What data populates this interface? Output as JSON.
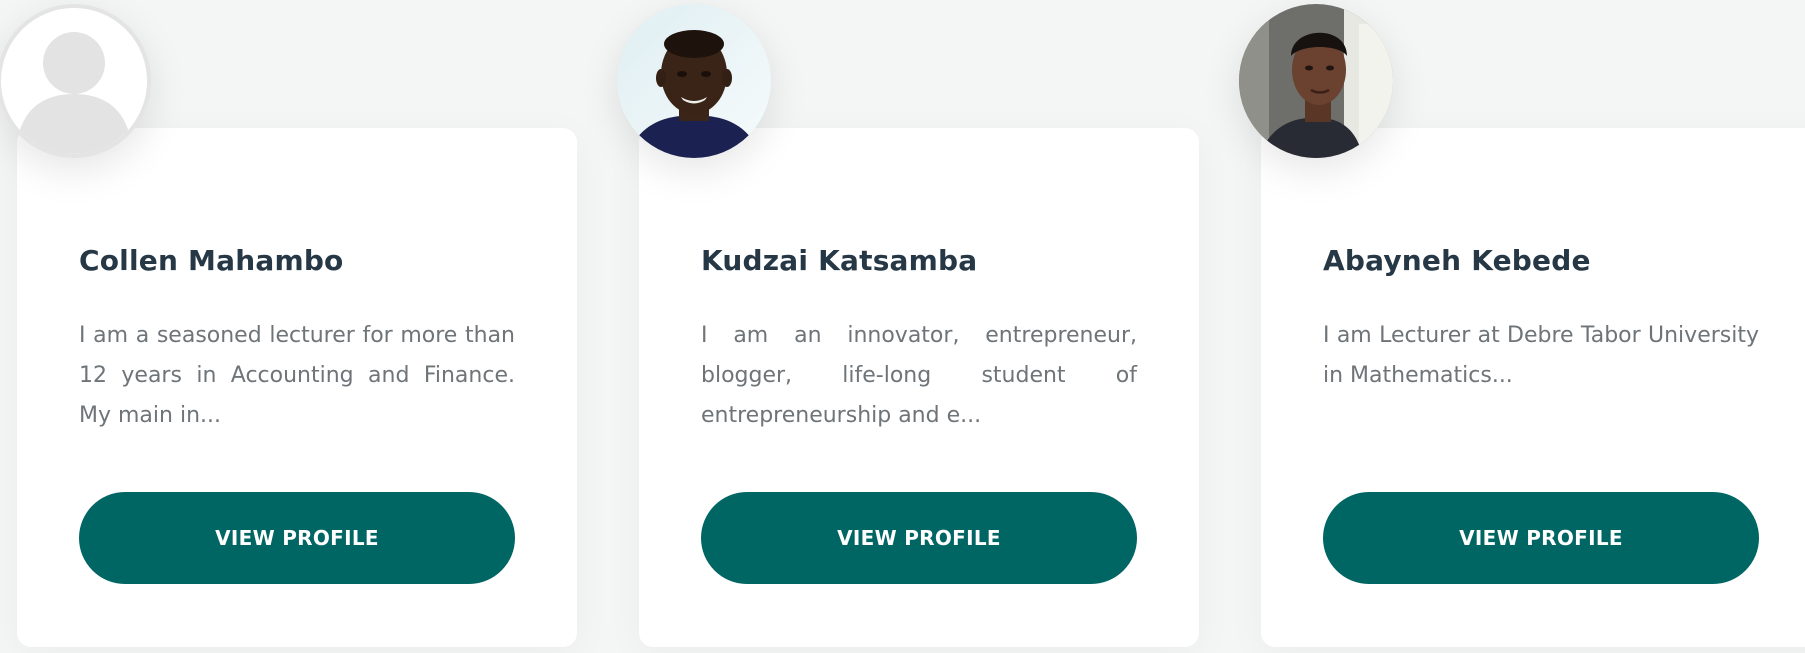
{
  "colors": {
    "page_bg": "#f4f5f5",
    "card_bg": "#ffffff",
    "name_color": "#263746",
    "bio_color": "#6e7478",
    "button_bg": "#006664",
    "button_text": "#ffffff"
  },
  "profiles": [
    {
      "name": "Collen Mahambo",
      "bio": "I am a seasoned lecturer for more than 12 years in Accounting and Finance. My main in...",
      "button_label": "VIEW PROFILE",
      "avatar": "default-user-icon"
    },
    {
      "name": "Kudzai Katsamba",
      "bio": "I am an innovator, entrepreneur, blogger, life-long student of entrepreneurship and e...",
      "button_label": "VIEW PROFILE",
      "avatar": "user-photo"
    },
    {
      "name": "Abayneh Kebede",
      "bio": "I am Lecturer at Debre Tabor University in Mathematics...",
      "button_label": "VIEW PROFILE",
      "avatar": "user-photo"
    }
  ]
}
